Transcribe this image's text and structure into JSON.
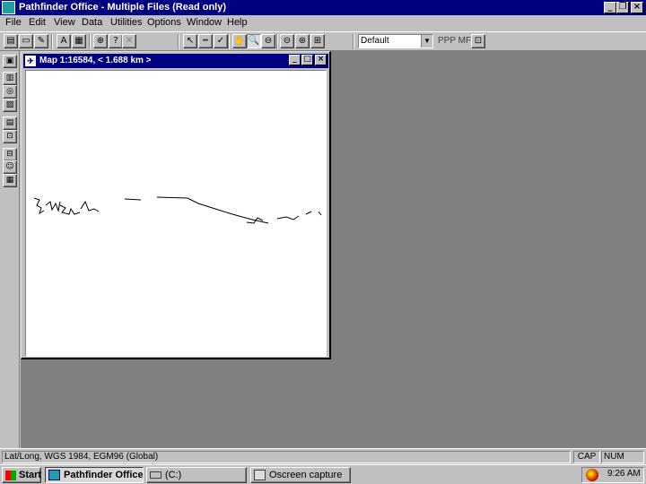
{
  "window": {
    "title": "Pathfinder Office - Multiple Files (Read only)",
    "app_icon": "pathfinder-app-icon",
    "minimize_glyph": "_",
    "restore_glyph": "❐",
    "close_glyph": "×"
  },
  "menu": [
    "File",
    "Edit",
    "View",
    "Data",
    "Utilities",
    "Options",
    "Window",
    "Help"
  ],
  "toolbar": {
    "buttons_left": [
      {
        "name": "open-icon",
        "glyph": "▤"
      },
      {
        "name": "save-icon",
        "glyph": "▭"
      },
      {
        "name": "edit-icon",
        "glyph": "✎"
      },
      {
        "name": "font-icon",
        "glyph": "A"
      },
      {
        "name": "table-icon",
        "glyph": "▦"
      },
      {
        "name": "layer-icon",
        "glyph": "⊕"
      },
      {
        "name": "query-icon",
        "glyph": "?"
      },
      {
        "name": "crossed-icon",
        "glyph": "✕"
      }
    ],
    "buttons_mid": [
      {
        "name": "select-arrow-icon",
        "glyph": "↖"
      },
      {
        "name": "measure-icon",
        "glyph": "┅"
      },
      {
        "name": "pencil-icon",
        "glyph": "✓"
      }
    ],
    "buttons_zoom": [
      {
        "name": "pan-hand-icon",
        "glyph": "✋"
      },
      {
        "name": "zoom-in-icon",
        "glyph": "🔍"
      },
      {
        "name": "zoom-out-icon",
        "glyph": "⊖"
      },
      {
        "name": "zoom-previous-icon",
        "glyph": "⊝"
      },
      {
        "name": "zoom-extents-icon",
        "glyph": "⊛"
      },
      {
        "name": "zoom-all-icon",
        "glyph": "⊞"
      }
    ],
    "style_select": "Default",
    "format_label": "PPP MF",
    "properties_icon": "properties-icon"
  },
  "left_toolbar": [
    {
      "name": "map-view-icon",
      "glyph": "▣"
    },
    {
      "name": "time-line-icon",
      "glyph": "▥"
    },
    {
      "name": "position-icon",
      "glyph": "◎"
    },
    {
      "name": "satellite-icon",
      "glyph": "▨"
    },
    {
      "name": "attribute-icon",
      "glyph": "▤"
    },
    {
      "name": "differential-icon",
      "glyph": "⊡"
    },
    {
      "name": "import-icon",
      "glyph": "⊟"
    },
    {
      "name": "export-icon",
      "glyph": "⊞"
    },
    {
      "name": "person-icon",
      "glyph": "☺"
    },
    {
      "name": "data-dictionary-icon",
      "glyph": "▦"
    }
  ],
  "map_window": {
    "title": "Map 1:16584, < 1.688 km >",
    "icon_glyph": "✈"
  },
  "status_bar": {
    "coordinates": "Lat/Long, WGS 1984, EGM96 (Global)",
    "caps": "CAP",
    "num": "NUM"
  },
  "taskbar": {
    "start_label": "Start",
    "tasks": [
      {
        "label": "Pathfinder Office",
        "active": true
      },
      {
        "label": "(C:)",
        "active": false
      },
      {
        "label": "Oscreen capture",
        "active": false
      }
    ],
    "clock": "9:26 AM"
  },
  "colors": {
    "title_bar": "#000080",
    "face": "#c0c0c0",
    "mdi_background": "#808080",
    "map_background": "#ffffff"
  }
}
